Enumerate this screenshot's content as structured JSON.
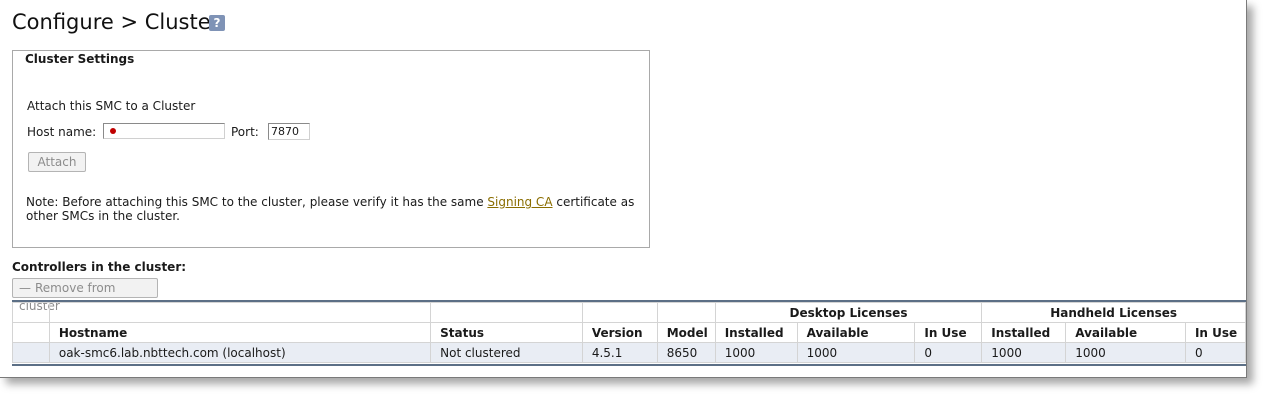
{
  "header": {
    "title": "Configure > Cluster",
    "help_label": "?"
  },
  "settings": {
    "legend": "Cluster Settings",
    "attach_label": "Attach this SMC to a Cluster",
    "host_label": "Host name:",
    "host_value": "",
    "port_label": "Port:",
    "port_value": "7870",
    "attach_button": "Attach",
    "note_before": "Note: Before attaching this SMC to the cluster, please verify it has the same ",
    "note_link": "Signing CA",
    "note_after": " certificate as other SMCs in the cluster."
  },
  "controllers": {
    "title": "Controllers in the cluster:",
    "remove_button": "Remove from cluster",
    "group_headers": {
      "desktop": "Desktop Licenses",
      "handheld": "Handheld Licenses"
    },
    "columns": {
      "hostname": "Hostname",
      "status": "Status",
      "version": "Version",
      "model": "Model",
      "desktop_installed": "Installed",
      "desktop_available": "Available",
      "desktop_in_use": "In Use",
      "handheld_installed": "Installed",
      "handheld_available": "Available",
      "handheld_in_use": "In Use"
    },
    "rows": [
      {
        "hostname": "oak-smc6.lab.nbttech.com (localhost)",
        "status": "Not clustered",
        "version": "4.5.1",
        "model": "8650",
        "desktop_installed": "1000",
        "desktop_available": "1000",
        "desktop_in_use": "0",
        "handheld_installed": "1000",
        "handheld_available": "1000",
        "handheld_in_use": "0"
      }
    ]
  }
}
